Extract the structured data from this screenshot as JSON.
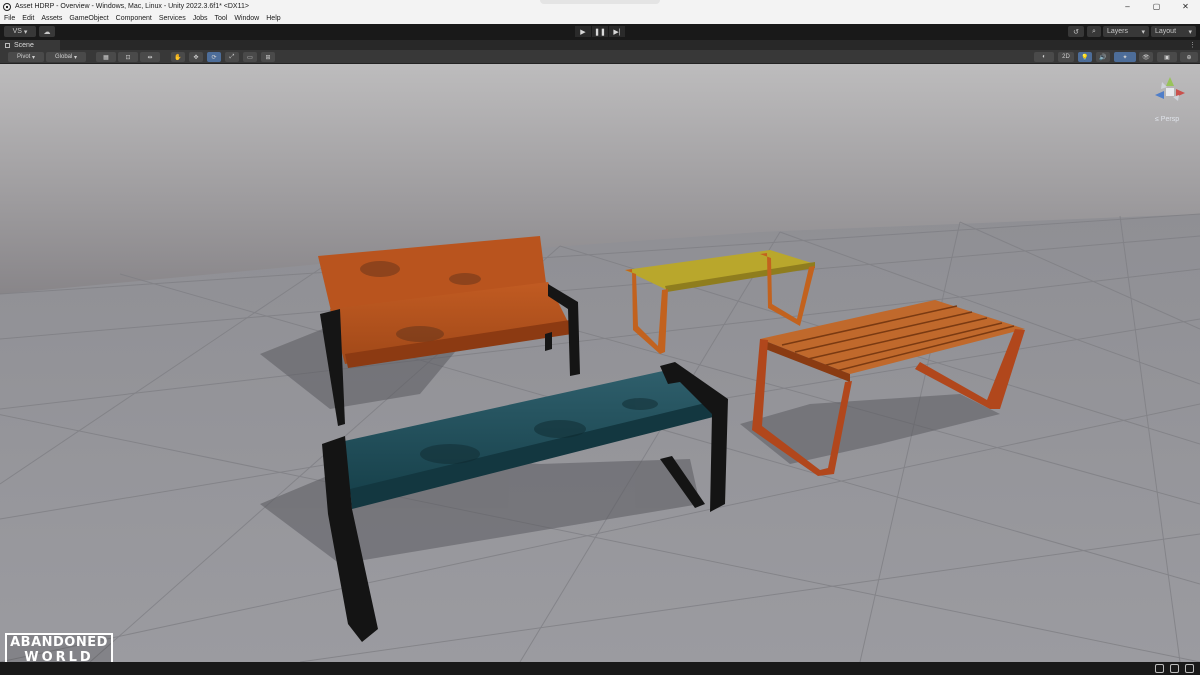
{
  "window": {
    "title": "Asset HDRP - Overview - Windows, Mac, Linux - Unity 2022.3.6f1* <DX11>",
    "controls": {
      "minimize": "–",
      "maximize": "▢",
      "close": "✕"
    }
  },
  "menu": [
    "File",
    "Edit",
    "Assets",
    "GameObject",
    "Component",
    "Services",
    "Jobs",
    "Tool",
    "Window",
    "Help"
  ],
  "toolbar": {
    "account": "VS",
    "account_arrow": "▾",
    "cloud_icon": "☁",
    "play": "▶",
    "pause": "❚❚",
    "step": "▶|",
    "history_icon": "↺",
    "search_icon": "⌕",
    "layers": "Layers",
    "layout": "Layout",
    "dropdown_arrow": "▾"
  },
  "scene": {
    "tab_label": "Scene",
    "menu_icon": "⋮",
    "pivot": "Pivot",
    "global": "Global",
    "mode_2d": "2D",
    "persp": "Persp",
    "persp_prefix": "≤ "
  },
  "tools": {
    "hand": "✋",
    "move": "✥",
    "rotate": "⟳",
    "scale": "⤢",
    "rect": "▭",
    "transform": "⊞",
    "grid": "▦",
    "snap": "⊡",
    "increment": "⇹"
  },
  "overlays": {
    "shading": "◐",
    "lighting": "💡",
    "audio": "🔊",
    "effects": "✦",
    "hidden": "👁",
    "camera": "▣",
    "gizmos": "⊕"
  },
  "logo": {
    "line1": "ABANDONED",
    "line2": "WORLD"
  },
  "colors": {
    "selected_tool": "#4d6d99",
    "orange_bench": "#b5501f",
    "blue_bench": "#1f4a55",
    "yellow_bench": "#b8a62a",
    "wood_bench": "#b8602a"
  }
}
